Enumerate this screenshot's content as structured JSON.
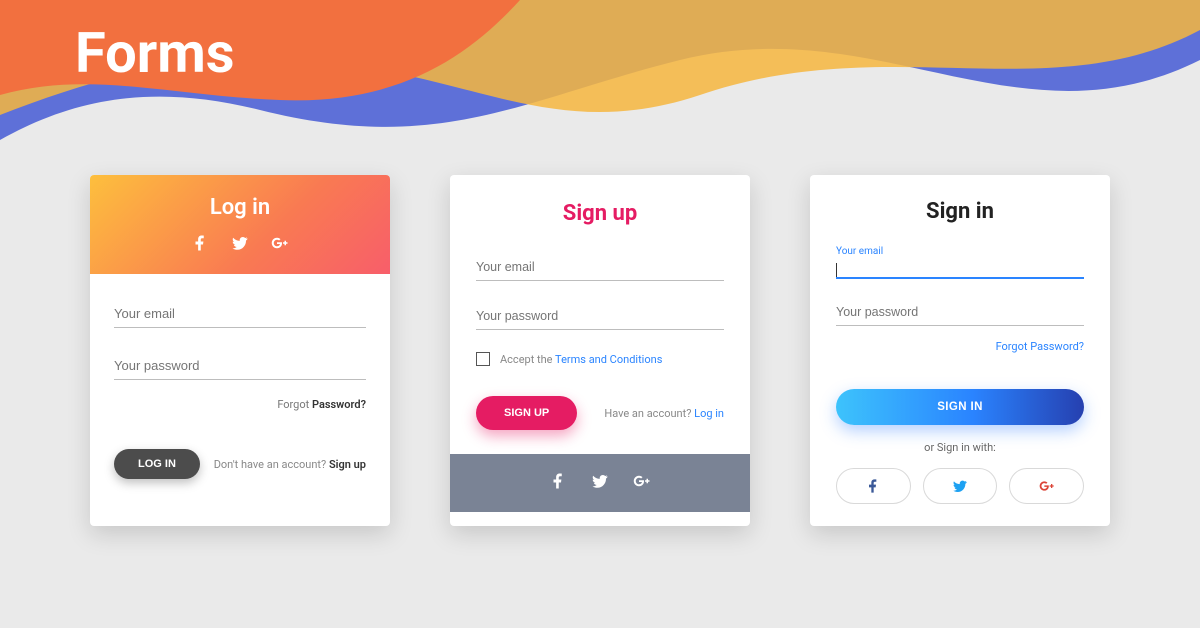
{
  "page_title": "Forms",
  "card1": {
    "title": "Log in",
    "email_placeholder": "Your email",
    "password_placeholder": "Your password",
    "forgot_prefix": "Forgot ",
    "forgot_bold": "Password?",
    "login_button": "LOG IN",
    "hint_prefix": "Don't have an account? ",
    "hint_link": "Sign up"
  },
  "card2": {
    "title": "Sign up",
    "email_placeholder": "Your email",
    "password_placeholder": "Your password",
    "terms_prefix": "Accept the ",
    "terms_link": "Terms and Conditions",
    "signup_button": "SIGN UP",
    "hint_prefix": "Have an account? ",
    "hint_link": "Log in"
  },
  "card3": {
    "title": "Sign in",
    "email_label": "Your email",
    "password_placeholder": "Your password",
    "forgot_link": "Forgot Password?",
    "signin_button": "SIGN IN",
    "or_text": "or Sign in with:"
  }
}
